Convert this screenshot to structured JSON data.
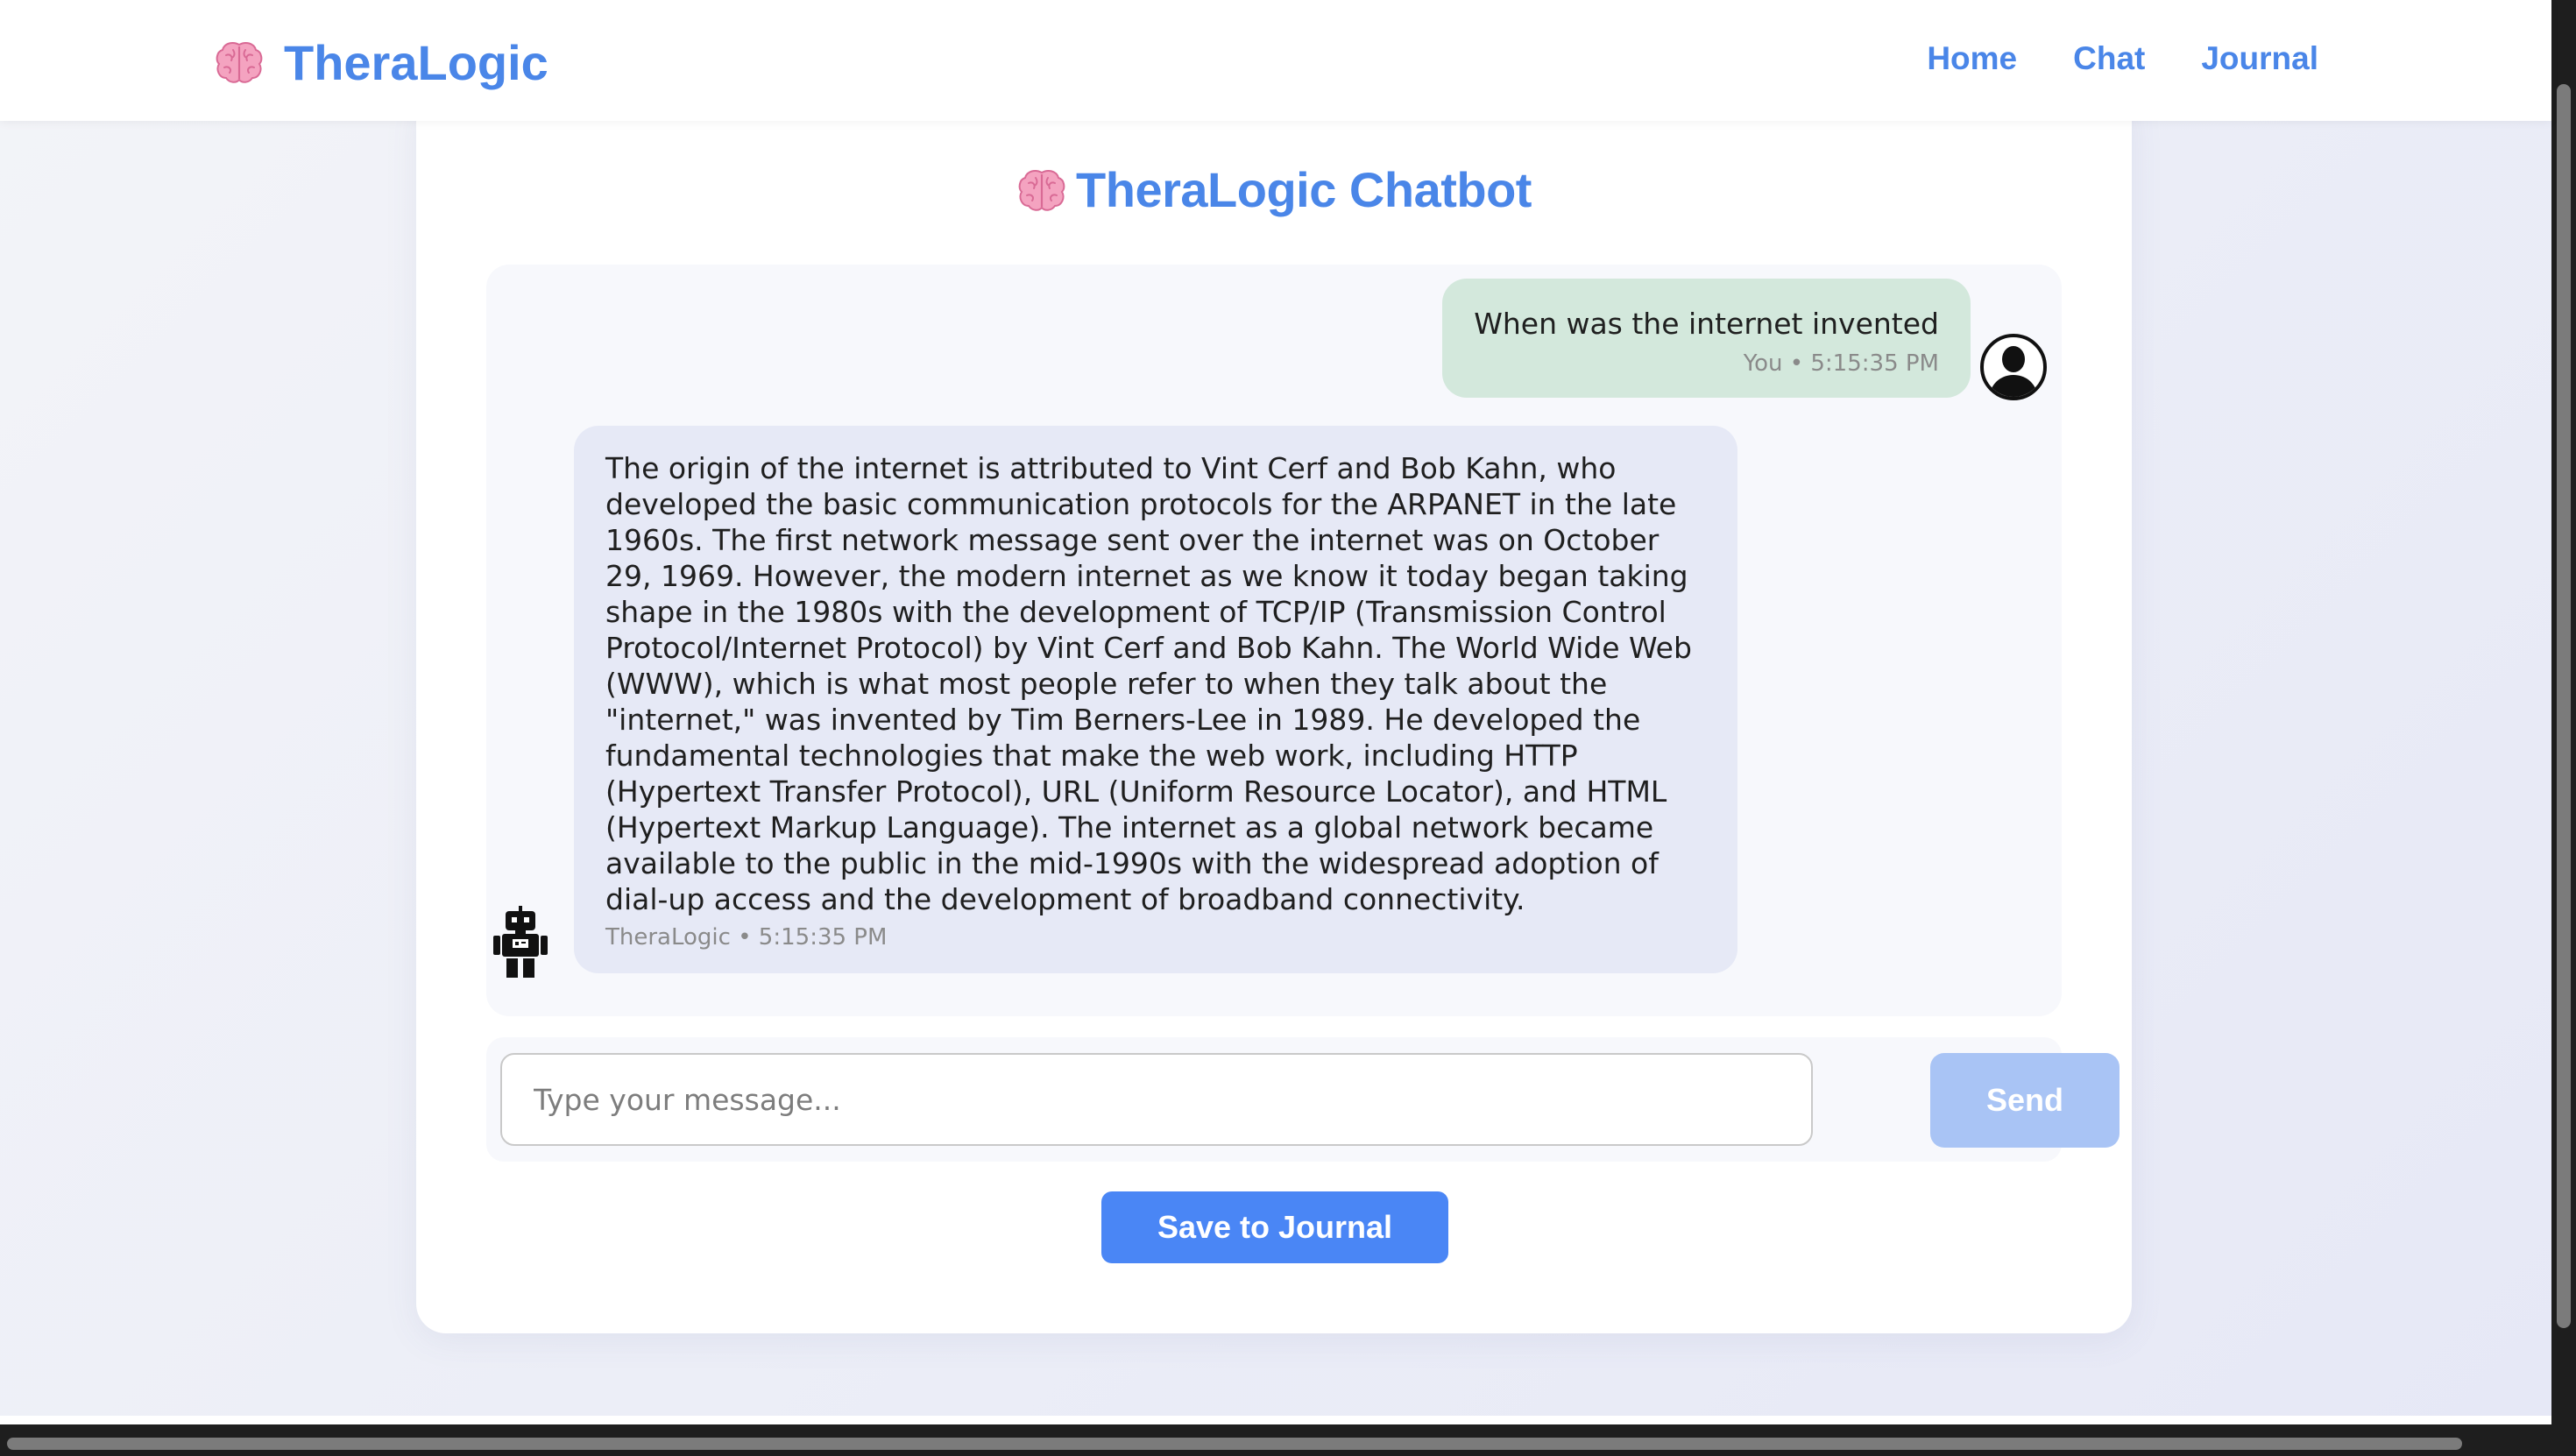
{
  "app": {
    "brand_name": "TheraLogic",
    "brand_icon": "brain-icon",
    "accent_color": "#4a86e8"
  },
  "nav": {
    "items": [
      {
        "label": "Home"
      },
      {
        "label": "Chat"
      },
      {
        "label": "Journal"
      }
    ]
  },
  "chat": {
    "title": "TheraLogic Chatbot",
    "messages": [
      {
        "sender": "You",
        "text": "When was the internet invented",
        "time": "5:15:35 PM",
        "meta": "You • 5:15:35 PM",
        "avatar_icon": "user-silhouette-icon",
        "bubble_color": "#d3e8dc"
      },
      {
        "sender": "TheraLogic",
        "text": "The origin of the internet is attributed to Vint Cerf and Bob Kahn, who developed the basic communication protocols for the ARPANET in the late 1960s. The first network message sent over the internet was on October 29, 1969. However, the modern internet as we know it today began taking shape in the 1980s with the development of TCP/IP (Transmission Control Protocol/Internet Protocol) by Vint Cerf and Bob Kahn. The World Wide Web (WWW), which is what most people refer to when they talk about the \"internet,\" was invented by Tim Berners-Lee in 1989. He developed the fundamental technologies that make the web work, including HTTP (Hypertext Transfer Protocol), URL (Uniform Resource Locator), and HTML (Hypertext Markup Language). The internet as a global network became available to the public in the mid-1990s with the widespread adoption of dial-up access and the development of broadband connectivity.",
        "time": "5:15:35 PM",
        "meta": "TheraLogic • 5:15:35 PM",
        "avatar_icon": "robot-icon",
        "bubble_color": "#e6e9f6"
      }
    ]
  },
  "composer": {
    "placeholder": "Type your message...",
    "value": "",
    "send_label": "Send",
    "send_color": "#a9c4f5"
  },
  "save_label": "Save to Journal",
  "save_color": "#4a86f5"
}
